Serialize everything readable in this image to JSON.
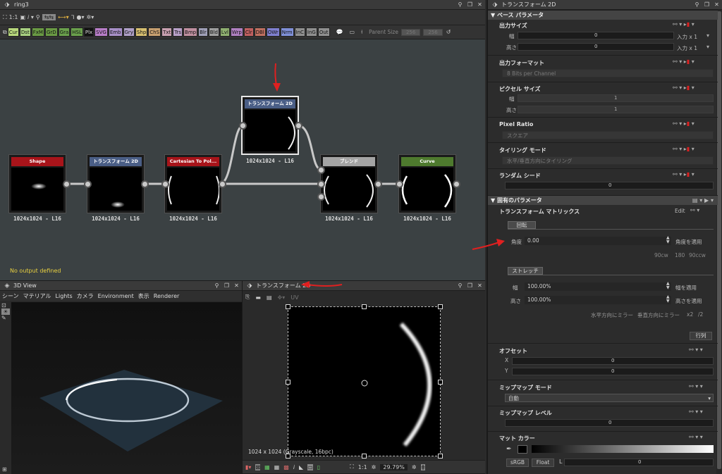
{
  "graph": {
    "title": "ring3",
    "zoom_label": "1:1",
    "filters": [
      {
        "label": "Cur",
        "color": "#b8d87c"
      },
      {
        "label": "Dst",
        "color": "#a8d080"
      },
      {
        "label": "FxM",
        "color": "#6a9a44"
      },
      {
        "label": "GrD",
        "color": "#6a9a44"
      },
      {
        "label": "Gra",
        "color": "#6aa04c"
      },
      {
        "label": "HSL",
        "color": "#6aa04c"
      },
      {
        "label": "Plx",
        "color": "#111"
      },
      {
        "label": "SVG",
        "color": "#b87ec8"
      },
      {
        "label": "Emb",
        "color": "#a890c8"
      },
      {
        "label": "Gry",
        "color": "#b0a0c8"
      },
      {
        "label": "Shp",
        "color": "#d8c070"
      },
      {
        "label": "ChS",
        "color": "#c8a070"
      },
      {
        "label": "Txt",
        "color": "#c8a0b0"
      },
      {
        "label": "Trs",
        "color": "#b8a0c8"
      },
      {
        "label": "Bmp",
        "color": "#c090a0"
      },
      {
        "label": "Blr",
        "color": "#a0a0b8"
      },
      {
        "label": "Bld",
        "color": "#a0a0a0"
      },
      {
        "label": "Lvl",
        "color": "#90b070"
      },
      {
        "label": "Wrp",
        "color": "#b080c0"
      },
      {
        "label": "Clr",
        "color": "#c06060"
      },
      {
        "label": "DBl",
        "color": "#c07060"
      },
      {
        "label": "OWr",
        "color": "#8080d0"
      },
      {
        "label": "Nrm",
        "color": "#8090d8"
      },
      {
        "label": "InC",
        "color": "#909090"
      },
      {
        "label": "InG",
        "color": "#909090"
      },
      {
        "label": "Out",
        "color": "#909090"
      }
    ],
    "parent_size_label": "Parent Size",
    "parent_w": "256",
    "parent_h": "256",
    "status": "No output defined",
    "nodes": [
      {
        "title": "Shape",
        "header_color": "#a8141a",
        "res": "1024x1024 - L16"
      },
      {
        "title": "トランスフォーム 2D",
        "header_color": "#4a5e86",
        "res": "1024x1024 - L16"
      },
      {
        "title": "Cartesian To Pol...",
        "header_color": "#a8141a",
        "res": "1024x1024 - L16"
      },
      {
        "title": "トランスフォーム 2D",
        "header_color": "#4a5e86",
        "res": "1024x1024 - L16"
      },
      {
        "title": "ブレンド",
        "header_color": "#a4a4a4",
        "res": "1024x1024 - L16"
      },
      {
        "title": "Curve",
        "header_color": "#4e7a2e",
        "res": "1024x1024 - L16"
      }
    ]
  },
  "view3d": {
    "title": "3D View",
    "menu": [
      "シーン",
      "マテリアル",
      "Lights",
      "カメラ",
      "Environment",
      "表示",
      "Renderer"
    ]
  },
  "view2d": {
    "title": "トランスフォーム 2D",
    "uv": "UV",
    "info": "1024 x 1024 (Grayscale, 16bpc)",
    "zoom_ratio": "1:1",
    "zoom": "29.79%"
  },
  "props": {
    "title": "トランスフォーム 2D",
    "base_params": "ベース パラメータ",
    "output_size": "出力サイズ",
    "width": "幅",
    "height": "高さ",
    "output_w_val": "0",
    "output_h_val": "0",
    "input_x1": "入力 x 1",
    "output_format": "出力フォーマット",
    "output_format_val": "8 Bits per Channel",
    "pixel_size": "ピクセル サイズ",
    "pixel_w_val": "1",
    "pixel_h_val": "1",
    "pixel_ratio": "Pixel Ratio",
    "pixel_ratio_val": "スクエア",
    "tiling": "タイリング モード",
    "tiling_val": "水平/垂直方向にタイリング",
    "random_seed": "ランダム シード",
    "random_seed_val": "0",
    "specific_params": "固有のパラメータ",
    "transform_matrix": "トランスフォーム マトリックス",
    "edit": "Edit",
    "rotate_tab": "回転",
    "angle": "角度",
    "angle_val": "0.00",
    "apply_angle": "角度を適用",
    "rot_presets": [
      "90cw",
      "180",
      "90ccw"
    ],
    "stretch_tab": "ストレッチ",
    "stretch_w_val": "100.00%",
    "apply_width": "幅を適用",
    "stretch_h_val": "100.00%",
    "apply_height": "高さを適用",
    "mirror_h": "水平方向にミラー",
    "mirror_v": "垂直方向にミラー",
    "scale_presets": [
      "x2",
      "/2"
    ],
    "matrix_btn": "行列",
    "offset": "オフセット",
    "offset_x": "X",
    "offset_y": "Y",
    "offset_x_val": "0",
    "offset_y_val": "0",
    "mip_mode": "ミップマップ モード",
    "mip_mode_val": "自動",
    "mip_level": "ミップマップ レベル",
    "mip_level_val": "0",
    "matte": "マット カラー",
    "srgb": "sRGB",
    "float": "Float",
    "matte_val": "0"
  }
}
